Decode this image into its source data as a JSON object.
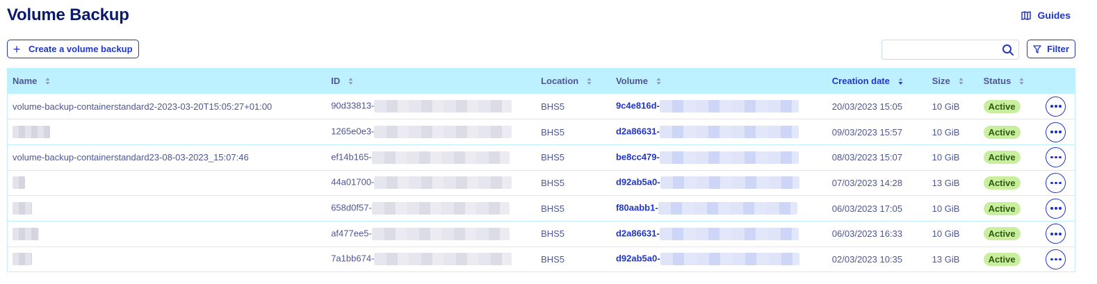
{
  "page": {
    "title": "Volume Backup",
    "guides_label": "Guides",
    "create_label": "Create a volume backup",
    "filter_label": "Filter",
    "search_placeholder": ""
  },
  "table": {
    "columns": [
      {
        "key": "name",
        "label": "Name",
        "sorted": false
      },
      {
        "key": "id",
        "label": "ID",
        "sorted": false
      },
      {
        "key": "location",
        "label": "Location",
        "sorted": false
      },
      {
        "key": "volume",
        "label": "Volume",
        "sorted": false
      },
      {
        "key": "created",
        "label": "Creation date",
        "sorted": true
      },
      {
        "key": "size",
        "label": "Size",
        "sorted": false
      },
      {
        "key": "status",
        "label": "Status",
        "sorted": false
      }
    ],
    "rows": [
      {
        "name": "volume-backup-containerstandard2-2023-03-20T15:05:27+01:00",
        "id": "90d33813-",
        "location": "BHS5",
        "volume": "9c4e816d-",
        "created": "20/03/2023 15:05",
        "size": "10 GiB",
        "status": "Active"
      },
      {
        "name": "",
        "id": "1265e0e3-",
        "location": "BHS5",
        "volume": "d2a86631-",
        "created": "09/03/2023 15:57",
        "size": "10 GiB",
        "status": "Active"
      },
      {
        "name": "volume-backup-containerstandard23-08-03-2023_15:07:46",
        "id": "ef14b165-",
        "location": "BHS5",
        "volume": "be8cc479-",
        "created": "08/03/2023 15:07",
        "size": "10 GiB",
        "status": "Active"
      },
      {
        "name": "",
        "id": "44a01700-",
        "location": "BHS5",
        "volume": "d92ab5a0-",
        "created": "07/03/2023 14:28",
        "size": "13 GiB",
        "status": "Active"
      },
      {
        "name": "",
        "id": "658d0f57-",
        "location": "BHS5",
        "volume": "f80aabb1-",
        "created": "06/03/2023 17:05",
        "size": "10 GiB",
        "status": "Active"
      },
      {
        "name": "",
        "id": "af477ee5-",
        "location": "BHS5",
        "volume": "d2a86631-",
        "created": "06/03/2023 16:33",
        "size": "10 GiB",
        "status": "Active"
      },
      {
        "name": "",
        "id": "7a1bb674-",
        "location": "BHS5",
        "volume": "d92ab5a0-",
        "created": "02/03/2023 10:35",
        "size": "13 GiB",
        "status": "Active"
      }
    ]
  },
  "icons": {
    "guides": "book-icon",
    "create": "plus-icon",
    "search": "search-icon",
    "filter": "filter-icon",
    "sort": "sort-icon",
    "row_actions": "more-icon"
  },
  "colors": {
    "primary": "#1f35c9",
    "heading": "#0a1a6b",
    "header_bg": "#bef1ff",
    "text": "#4d5693",
    "active_badge_bg": "#c9ef9e"
  }
}
